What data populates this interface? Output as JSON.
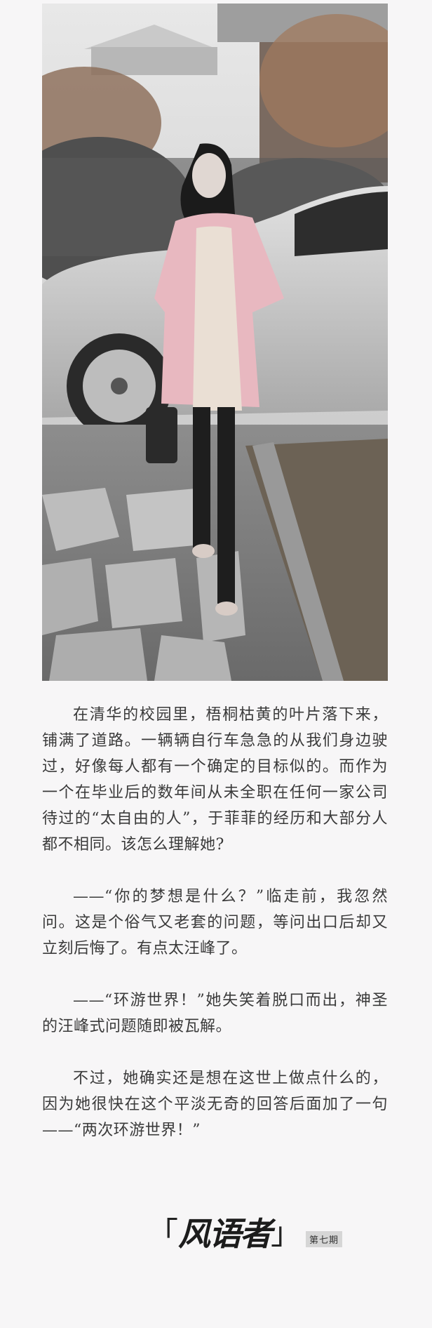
{
  "photo": {
    "description_icon": "portrait-photo-icon"
  },
  "article": {
    "paragraphs": [
      "在清华的校园里，梧桐枯黄的叶片落下来，铺满了道路。一辆辆自行车急急的从我们身边驶过，好像每人都有一个确定的目标似的。而作为一个在毕业后的数年间从未全职在任何一家公司待过的“太自由的人”，于菲菲的经历和大部分人都不相同。该怎么理解她?",
      "——“你的梦想是什么？”临走前，我忽然问。这是个俗气又老套的问题，等问出口后却又立刻后悔了。有点太汪峰了。",
      "——“环游世界！”她失笑着脱口而出，神圣的汪峰式问题随即被瓦解。",
      "不过，她确实还是想在这世上做点什么的，因为她很快在这个平淡无奇的回答后面加了一句——“两次环游世界！”"
    ]
  },
  "footer": {
    "bracket_open": "「",
    "logo": "风语者",
    "bracket_close": "」",
    "issue": "第七期"
  }
}
